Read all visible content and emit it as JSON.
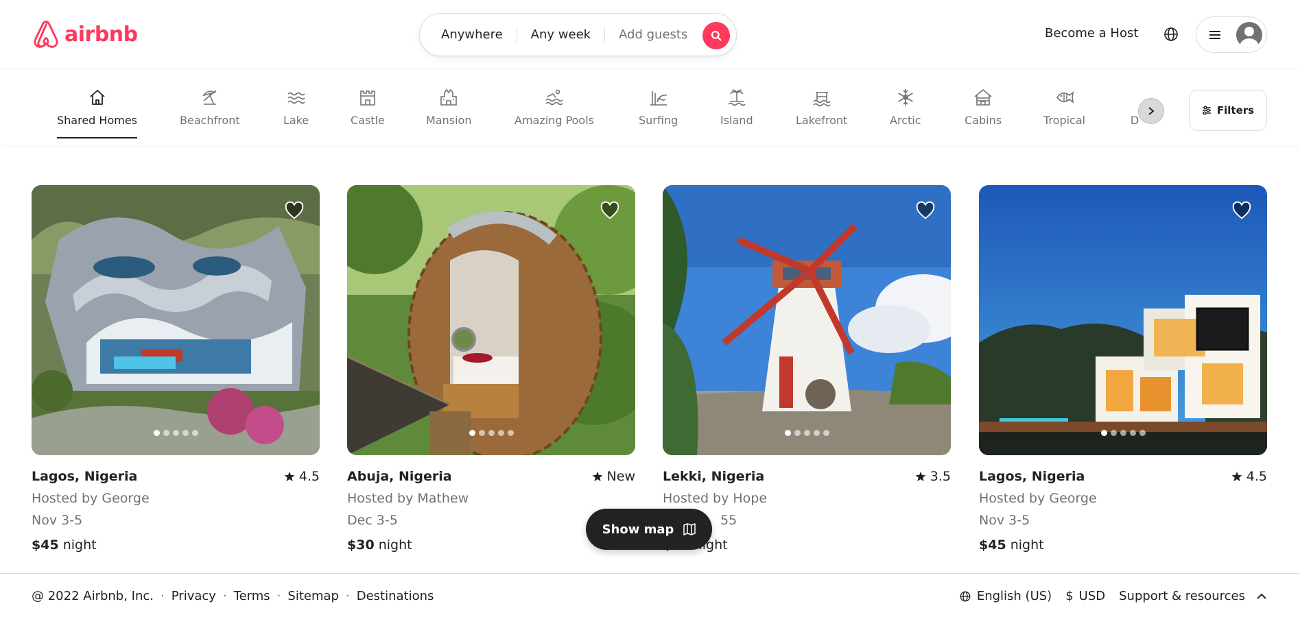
{
  "brand": {
    "name": "airbnb",
    "color": "#FF385C"
  },
  "search": {
    "location": "Anywhere",
    "dates": "Any week",
    "guests_placeholder": "Add guests"
  },
  "header": {
    "become_host": "Become a Host"
  },
  "categories": [
    {
      "label": "Shared Homes",
      "icon": "home-icon",
      "active": true
    },
    {
      "label": "Beachfront",
      "icon": "beach-umbrella-icon"
    },
    {
      "label": "Lake",
      "icon": "waves-icon"
    },
    {
      "label": "Castle",
      "icon": "castle-icon"
    },
    {
      "label": "Mansion",
      "icon": "mansion-icon"
    },
    {
      "label": "Amazing Pools",
      "icon": "pool-icon"
    },
    {
      "label": "Surfing",
      "icon": "surfing-icon"
    },
    {
      "label": "Island",
      "icon": "island-icon"
    },
    {
      "label": "Lakefront",
      "icon": "lakefront-icon"
    },
    {
      "label": "Arctic",
      "icon": "snowflake-icon"
    },
    {
      "label": "Cabins",
      "icon": "cabin-icon"
    },
    {
      "label": "Tropical",
      "icon": "tropical-fish-icon"
    },
    {
      "label": "D",
      "icon": ""
    }
  ],
  "filters_label": "Filters",
  "listings": [
    {
      "location": "Lagos, Nigeria",
      "rating": "4.5",
      "host": "Hosted by George",
      "dates": "Nov 3-5",
      "price": "$45",
      "unit": "night"
    },
    {
      "location": "Abuja, Nigeria",
      "rating": "New",
      "host": "Hosted by Mathew",
      "dates": "Dec 3-5",
      "price": "$30",
      "unit": "night"
    },
    {
      "location": "Lekki, Nigeria",
      "rating": "3.5",
      "host": "Hosted by Hope",
      "dates": "55",
      "price": "$50",
      "unit": "night"
    },
    {
      "location": "Lagos, Nigeria",
      "rating": "4.5",
      "host": "Hosted by George",
      "dates": "Nov 3-5",
      "price": "$45",
      "unit": "night"
    }
  ],
  "show_map": "Show map",
  "footer": {
    "copyright": "@ 2022 Airbnb, Inc.",
    "links": [
      "Privacy",
      "Terms",
      "Sitemap",
      "Destinations"
    ],
    "language": "English (US)",
    "currency_symbol": "$",
    "currency": "USD",
    "support": "Support & resources"
  }
}
